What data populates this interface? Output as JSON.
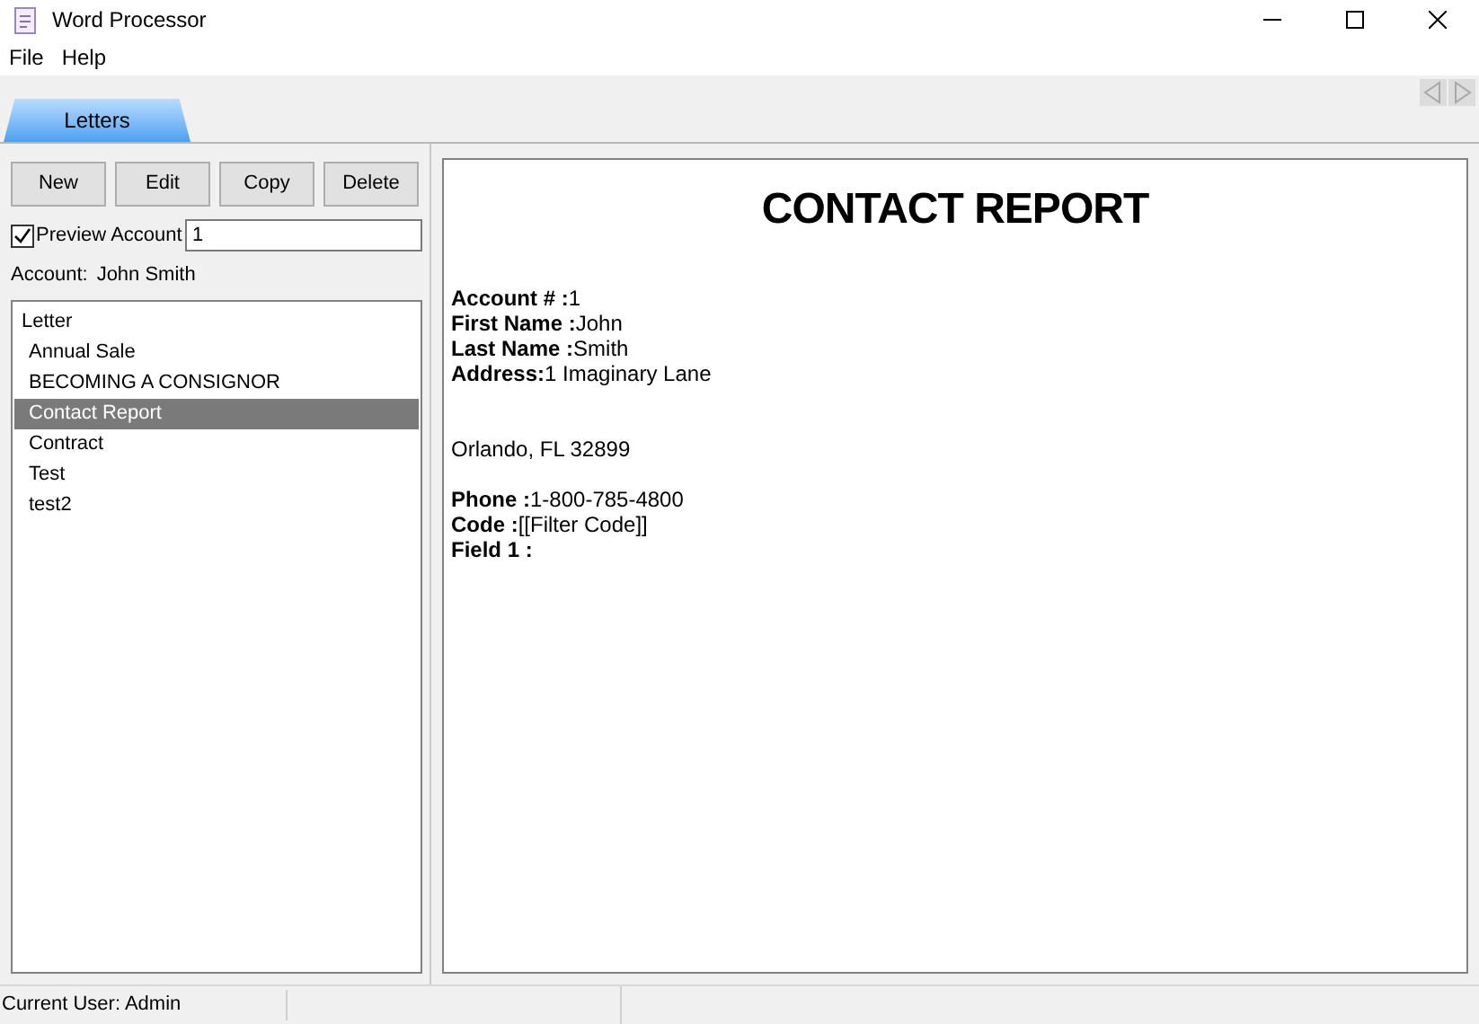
{
  "window": {
    "title": "Word Processor"
  },
  "menu": [
    "File",
    "Help"
  ],
  "tabs": [
    {
      "label": "Letters",
      "selected": true
    }
  ],
  "toolbar": [
    "New",
    "Edit",
    "Copy",
    "Delete"
  ],
  "preview": {
    "label": "Preview Account",
    "checked": true,
    "value": "1"
  },
  "account": {
    "label": "Account:",
    "value": "John Smith"
  },
  "tree": {
    "label": "Letter",
    "children": [
      {
        "label": "Annual Sale",
        "selected": false
      },
      {
        "label": "BECOMING A CONSIGNOR",
        "selected": false
      },
      {
        "label": "Contact Report",
        "selected": true
      },
      {
        "label": "Contract",
        "selected": false
      },
      {
        "label": "Test",
        "selected": false
      },
      {
        "label": "test2",
        "selected": false
      }
    ]
  },
  "document": {
    "title": "CONTACT REPORT",
    "paragraphs": [
      [
        "**Account # :**1",
        "**First Name :**John",
        "**Last Name :**Smith",
        "**Address:**1 Imaginary Lane"
      ],
      [
        "Orlando, FL  32899"
      ],
      [
        "**Phone :**1-800-785-4800",
        "**Code :**[[Filter Code]]",
        "**Field 1 :**"
      ]
    ]
  },
  "status_bar": [
    "Current User: Admin"
  ]
}
